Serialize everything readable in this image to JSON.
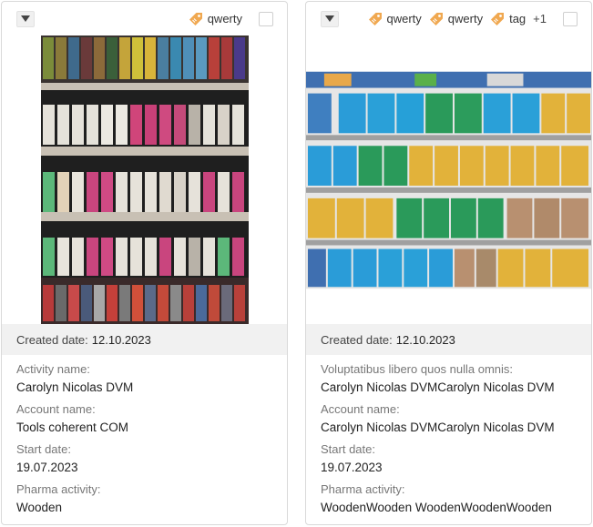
{
  "cards": [
    {
      "tags": [
        {
          "label": "qwerty"
        }
      ],
      "more_count": "",
      "image_alt": "Shelf with canned drinks",
      "created_label": "Created date:",
      "created_value": "12.10.2023",
      "fields": [
        {
          "label": "Activity name:",
          "value": "Carolyn Nicolas DVM"
        },
        {
          "label": "Account name:",
          "value": "Tools coherent COM"
        },
        {
          "label": "Start date:",
          "value": "19.07.2023"
        },
        {
          "label": "Pharma activity:",
          "value": "Wooden"
        }
      ]
    },
    {
      "tags": [
        {
          "label": "qwerty"
        },
        {
          "label": "qwerty"
        },
        {
          "label": "tag"
        }
      ],
      "more_count": "+1",
      "image_alt": "Shelf with cereal boxes",
      "created_label": "Created date:",
      "created_value": "12.10.2023",
      "fields": [
        {
          "label": "Voluptatibus libero quos nulla omnis:",
          "value": "Carolyn Nicolas DVMCarolyn Nicolas DVM"
        },
        {
          "label": "Account name:",
          "value": "Carolyn Nicolas DVMCarolyn Nicolas DVM"
        },
        {
          "label": "Start date:",
          "value": "19.07.2023"
        },
        {
          "label": "Pharma activity:",
          "value": "WoodenWooden WoodenWoodenWooden"
        }
      ]
    }
  ],
  "colors": {
    "tag_icon": "#f0a850",
    "created_bg": "#f1f1f1",
    "border": "#d9d9d9",
    "label_gray": "#777777"
  },
  "icons": {
    "expand": "chevron-down-icon",
    "tag": "tag-icon",
    "checkbox": "checkbox"
  }
}
